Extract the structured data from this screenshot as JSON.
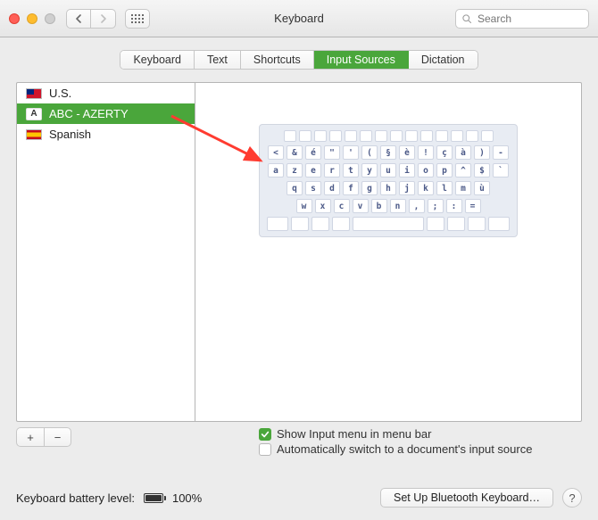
{
  "header": {
    "title": "Keyboard",
    "search_placeholder": "Search"
  },
  "tabs": [
    {
      "label": "Keyboard",
      "active": false
    },
    {
      "label": "Text",
      "active": false
    },
    {
      "label": "Shortcuts",
      "active": false
    },
    {
      "label": "Input Sources",
      "active": true
    },
    {
      "label": "Dictation",
      "active": false
    }
  ],
  "sources": [
    {
      "label": "U.S.",
      "icon": "flag-us",
      "selected": false
    },
    {
      "label": "ABC - AZERTY",
      "icon": "kbd-a",
      "selected": true
    },
    {
      "label": "Spanish",
      "icon": "flag-es",
      "selected": false
    }
  ],
  "keyboard_rows": [
    [
      "<",
      "&",
      "é",
      "\"",
      "'",
      "(",
      "§",
      "è",
      "!",
      "ç",
      "à",
      ")",
      "-"
    ],
    [
      "a",
      "z",
      "e",
      "r",
      "t",
      "y",
      "u",
      "i",
      "o",
      "p",
      "^",
      "$",
      "`"
    ],
    [
      "q",
      "s",
      "d",
      "f",
      "g",
      "h",
      "j",
      "k",
      "l",
      "m",
      "ù"
    ],
    [
      "w",
      "x",
      "c",
      "v",
      "b",
      "n",
      ",",
      ";",
      ":",
      "="
    ]
  ],
  "options": {
    "show_menu": {
      "label": "Show Input menu in menu bar",
      "checked": true
    },
    "auto_switch": {
      "label": "Automatically switch to a document's input source",
      "checked": false
    }
  },
  "footer": {
    "battery_label": "Keyboard battery level:",
    "battery_value": "100%",
    "bluetooth_btn": "Set Up Bluetooth Keyboard…",
    "help": "?"
  },
  "buttons": {
    "plus": "+",
    "minus": "−"
  }
}
